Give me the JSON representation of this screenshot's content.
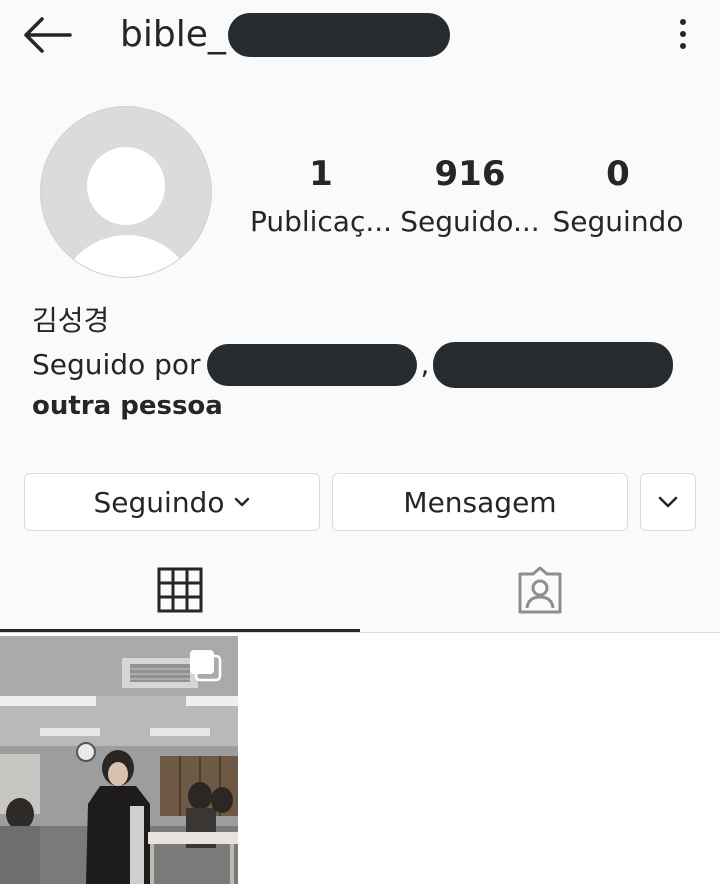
{
  "header": {
    "username": "bible_",
    "back_icon": "arrow-left-icon",
    "menu_icon": "more-vertical-icon"
  },
  "profile": {
    "avatar_icon": "default-avatar-icon",
    "stats": [
      {
        "value": "1",
        "label": "Publicaç..."
      },
      {
        "value": "916",
        "label": "Seguido..."
      },
      {
        "value": "0",
        "label": "Seguindo"
      }
    ],
    "full_name": "김성경",
    "followed_by_prefix": "Seguido por",
    "followed_by_separator": ",",
    "followed_by_suffix": "outra pessoa"
  },
  "actions": {
    "following_label": "Seguindo",
    "message_label": "Mensagem",
    "more_icon": "chevron-down-icon"
  },
  "tabs": [
    {
      "icon": "grid-icon",
      "active": true
    },
    {
      "icon": "tagged-person-icon",
      "active": false
    }
  ],
  "posts": [
    {
      "multi_photo_icon": "multiple-photos-icon"
    }
  ],
  "colors": {
    "background": "#fafafa",
    "text": "#262626",
    "border": "#dbdbdb",
    "redaction": "#262b30"
  }
}
